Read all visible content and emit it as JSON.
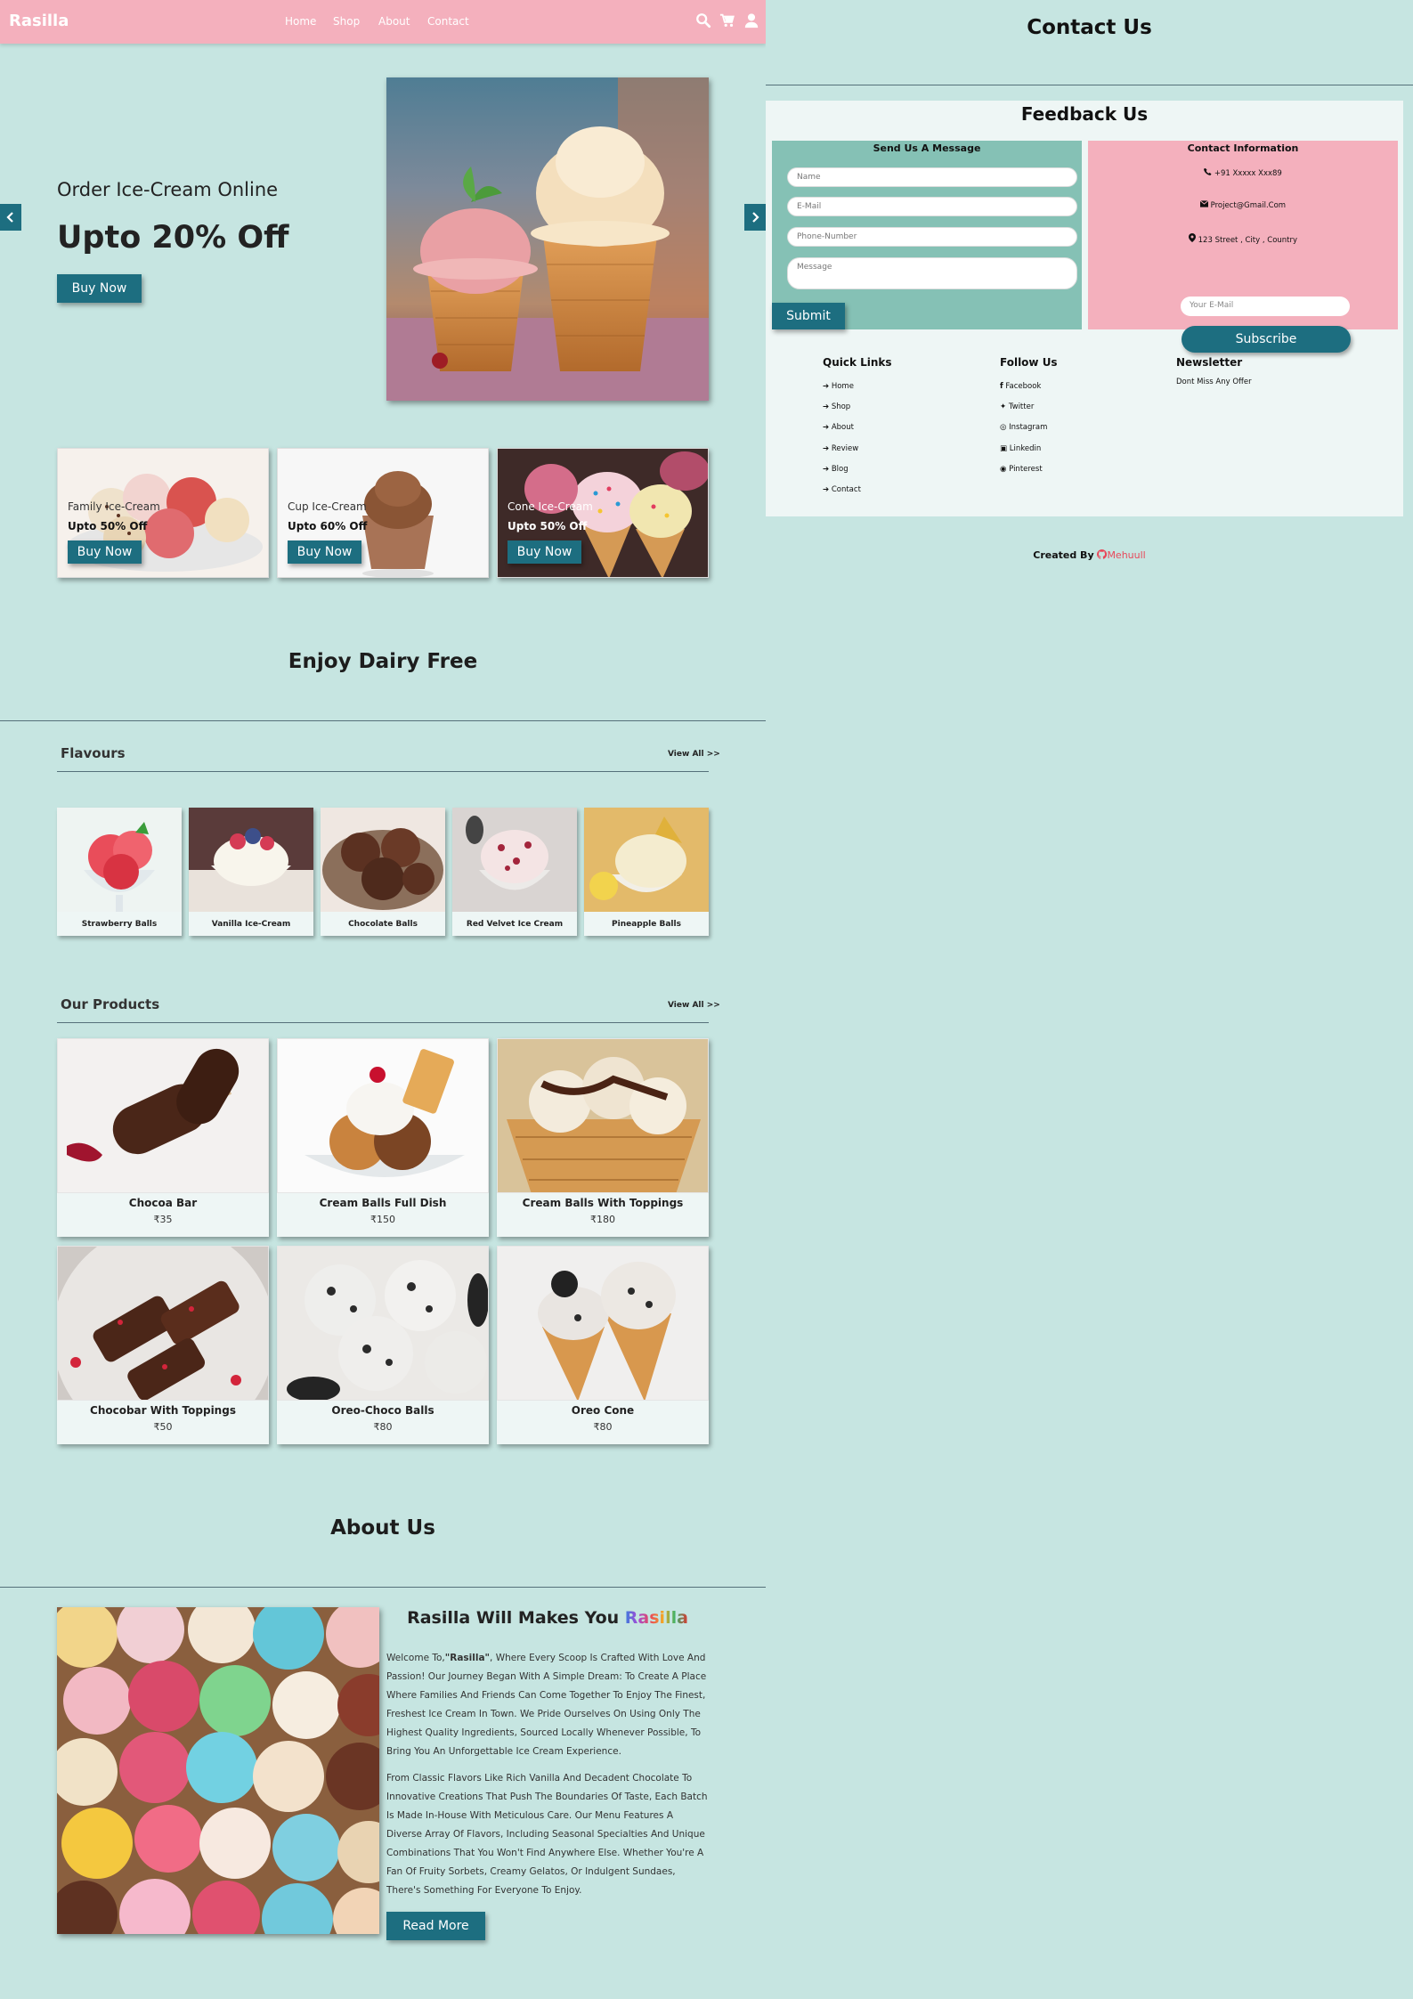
{
  "header": {
    "logo": "Rasilla",
    "nav": [
      "Home",
      "Shop",
      "About",
      "Contact"
    ]
  },
  "hero": {
    "subtitle": "Order Ice-Cream Online",
    "title": "Upto 20% Off",
    "button": "Buy Now"
  },
  "offers": [
    {
      "name": "Family Ice-Cream",
      "discount": "Upto 50% Off",
      "button": "Buy Now"
    },
    {
      "name": "Cup Ice-Cream",
      "discount": "Upto 60% Off",
      "button": "Buy Now"
    },
    {
      "name": "Cone Ice-Cream",
      "discount": "Upto 50% Off",
      "button": "Buy Now"
    }
  ],
  "dairy": {
    "title": "Enjoy Dairy Free"
  },
  "flavours": {
    "title": "Flavours",
    "view_all": "View All >>",
    "items": [
      "Strawberry Balls",
      "Vanilla Ice-Cream",
      "Chocolate Balls",
      "Red Velvet Ice Cream",
      "Pineapple Balls"
    ]
  },
  "products": {
    "title": "Our Products",
    "view_all": "View All >>",
    "items": [
      {
        "name": "Chocoa Bar",
        "price": "₹35"
      },
      {
        "name": "Cream Balls Full Dish",
        "price": "₹150"
      },
      {
        "name": "Cream Balls With Toppings",
        "price": "₹180"
      },
      {
        "name": "Chocobar With Toppings",
        "price": "₹50"
      },
      {
        "name": "Oreo-Choco Balls",
        "price": "₹80"
      },
      {
        "name": "Oreo Cone",
        "price": "₹80"
      }
    ]
  },
  "about": {
    "title": "About Us",
    "heading_prefix": "Rasilla Will Makes You ",
    "heading_colored": "Rasilla",
    "para1_prefix": "Welcome To,",
    "para1_brand": "\"Rasilla\"",
    "para1_rest": ", Where Every Scoop Is Crafted With Love And Passion! Our Journey Began With A Simple Dream: To Create A Place Where Families And Friends Can Come Together To Enjoy The Finest, Freshest Ice Cream In Town. We Pride Ourselves On Using Only The Highest Quality Ingredients, Sourced Locally Whenever Possible, To Bring You An Unforgettable Ice Cream Experience.",
    "para2": "From Classic Flavors Like Rich Vanilla And Decadent Chocolate To Innovative Creations That Push The Boundaries Of Taste, Each Batch Is Made In-House With Meticulous Care. Our Menu Features A Diverse Array Of Flavors, Including Seasonal Specialties And Unique Combinations That You Won't Find Anywhere Else. Whether You're A Fan Of Fruity Sorbets, Creamy Gelatos, Or Indulgent Sundaes, There's Something For Everyone To Enjoy.",
    "button": "Read More"
  },
  "contact": {
    "title": "Contact Us",
    "feedback_title": "Feedback Us",
    "form_title": "Send Us A Message",
    "placeholders": {
      "name": "Name",
      "email": "E-Mail",
      "phone": "Phone-Number",
      "message": "Message"
    },
    "submit": "Submit",
    "info_title": "Contact Information",
    "phone": "+91 Xxxxx Xxx89",
    "email": "Project@Gmail.Com",
    "address": "123 Street , City , Country"
  },
  "footer": {
    "quick_links_title": "Quick Links",
    "quick_links": [
      "Home",
      "Shop",
      "About",
      "Review",
      "Blog",
      "Contact"
    ],
    "follow_title": "Follow Us",
    "follow_links": [
      "Facebook",
      "Twitter",
      "Instagram",
      "Linkedin",
      "Pinterest"
    ],
    "newsletter_title": "Newsletter",
    "newsletter_text": "Dont Miss Any Offer",
    "newsletter_placeholder": "Your E-Mail",
    "subscribe": "Subscribe",
    "credit_prefix": "Created By ",
    "credit_name": "Mehuull"
  },
  "colors": {
    "header": "#f4b0bd",
    "background": "#c6e5e1",
    "button": "#1d6e80",
    "card": "#eef6f5",
    "form_panel": "#85c1b5",
    "info_panel": "#f4b0bd"
  }
}
